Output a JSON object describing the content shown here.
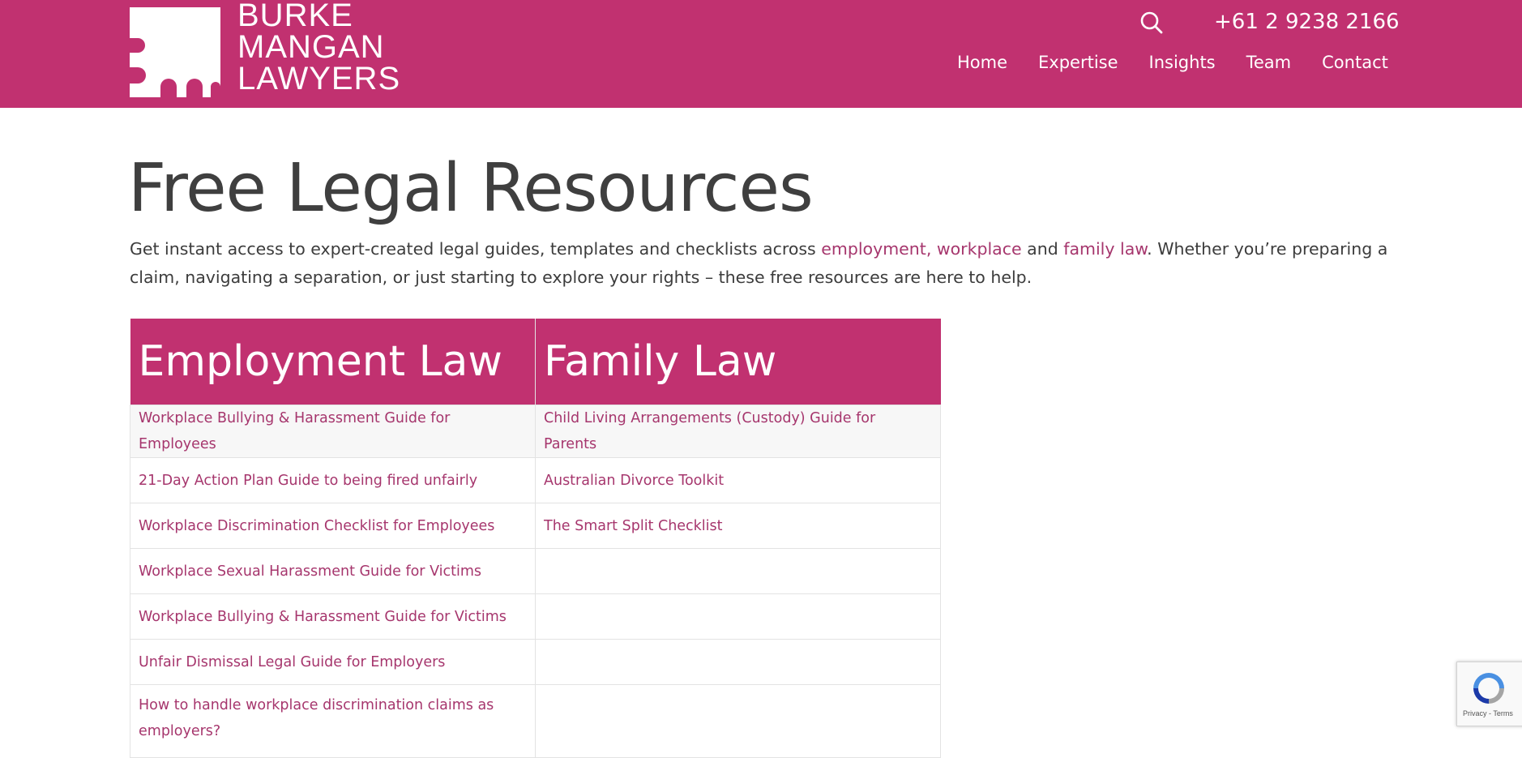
{
  "brand": {
    "logo_lines": [
      "BURKE",
      "MANGAN",
      "LAWYERS"
    ],
    "color": "#c13170",
    "logo_mark_icon": "bm-monogram-logo"
  },
  "header": {
    "phone": "+61 2 9238 2166",
    "search_icon": "search-icon",
    "nav": [
      "Home",
      "Expertise",
      "Insights",
      "Team",
      "Contact"
    ]
  },
  "main": {
    "title": "Free Legal Resources",
    "intro": {
      "text_1": "Get instant access to expert-created legal guides, templates and checklists across ",
      "link_employment": "employment, workplace",
      "text_2": " and ",
      "link_family": "family law",
      "text_3": ". Whether you’re preparing a claim, navigating a separation, or just starting to explore your rights – these free resources are here to help."
    },
    "table": {
      "headers": [
        "Employment Law",
        "Family Law"
      ],
      "rows": [
        [
          "Workplace Bullying & Harassment Guide for Employees",
          "Child Living Arrangements (Custody) Guide for Parents"
        ],
        [
          "21-Day Action Plan Guide to being fired unfairly",
          "Australian Divorce Toolkit"
        ],
        [
          "Workplace Discrimination Checklist for Employees",
          "The Smart Split Checklist"
        ],
        [
          "Workplace Sexual Harassment Guide for Victims",
          ""
        ],
        [
          "Workplace Bullying & Harassment Guide for Victims",
          ""
        ],
        [
          "Unfair Dismissal Legal Guide for Employers",
          ""
        ],
        [
          "How to handle workplace discrimination claims as employers?",
          ""
        ]
      ]
    }
  },
  "recaptcha": {
    "links": "Privacy - Terms",
    "icon": "recaptcha-icon"
  },
  "colors": {
    "accent": "#c13170",
    "link": "#a6366d",
    "text": "#3c3c3c"
  }
}
